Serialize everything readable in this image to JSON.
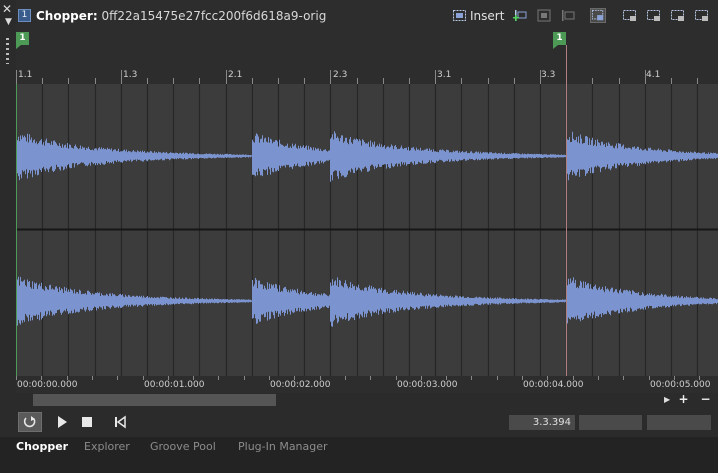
{
  "panel": {
    "track_number": "1",
    "name": "Chopper",
    "separator": ":",
    "clip_name": "0ff22a15475e27fcc200f6d618a9-orig",
    "insert_label": "Insert"
  },
  "toolbar_icons": [
    "insert-mode-icon",
    "add-split-icon",
    "prev-marker-icon",
    "next-marker-icon",
    "snap-to-grid-icon",
    "move-split-icon",
    "split-to-track-icon",
    "slice-icon",
    "slice-alt-icon"
  ],
  "markers": [
    "1",
    "1"
  ],
  "bar_labels": [
    "1.1",
    "1.3",
    "2.1",
    "2.3",
    "3.1",
    "3.3",
    "4.1"
  ],
  "time_labels": [
    "00:00:00.000",
    "00:00:01.000",
    "00:00:02.000",
    "00:00:03.000",
    "00:00:04.000",
    "00:00:05.000"
  ],
  "transport": {
    "position": "3.3.394",
    "field_2": "",
    "field_3": ""
  },
  "tabs": [
    {
      "label": "Chopper",
      "active": true
    },
    {
      "label": "Explorer",
      "active": false
    },
    {
      "label": "Groove Pool",
      "active": false
    },
    {
      "label": "Plug-In Manager",
      "active": false
    }
  ],
  "colors": {
    "waveform": "#7b93cf",
    "marker": "#4c9a55",
    "cursor": "#b08080",
    "background": "#3c3c3c"
  }
}
